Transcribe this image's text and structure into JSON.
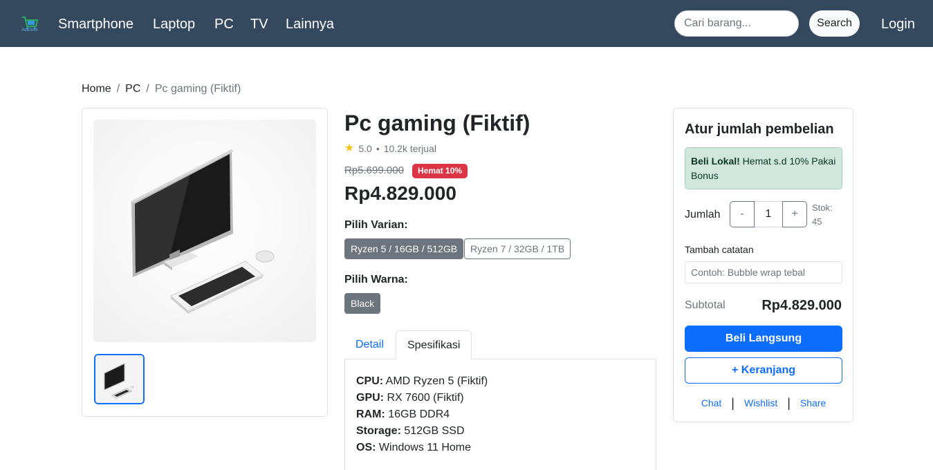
{
  "nav": {
    "logo_text": "AdaTech",
    "links": [
      "Smartphone",
      "Laptop",
      "PC",
      "TV",
      "Lainnya"
    ],
    "search_placeholder": "Cari barang...",
    "search_button": "Search",
    "login": "Login"
  },
  "breadcrumb": {
    "items": [
      "Home",
      "PC"
    ],
    "current": "Pc gaming (Fiktif)"
  },
  "product": {
    "title": "Pc gaming (Fiktif)",
    "rating": "5.0",
    "sold": "10.2k terjual",
    "rating_separator": "•",
    "old_price": "Rp5.699.000",
    "discount_badge": "Hemat 10%",
    "price": "Rp4.829.000",
    "variant_label": "Pilih Varian:",
    "variants": [
      "Ryzen 5 / 16GB / 512GB",
      "Ryzen 7 / 32GB / 1TB"
    ],
    "color_label": "Pilih Warna:",
    "colors": [
      "Black"
    ]
  },
  "tabs": {
    "items": [
      "Detail",
      "Spesifikasi"
    ],
    "active": "Spesifikasi"
  },
  "specs": [
    {
      "key": "CPU:",
      "value": "AMD Ryzen 5 (Fiktif)"
    },
    {
      "key": "GPU:",
      "value": "RX 7600 (Fiktif)"
    },
    {
      "key": "RAM:",
      "value": "16GB DDR4"
    },
    {
      "key": "Storage:",
      "value": "512GB SSD"
    },
    {
      "key": "OS:",
      "value": "Windows 11 Home"
    }
  ],
  "purchase": {
    "title": "Atur jumlah pembelian",
    "promo_bold": "Beli Lokal!",
    "promo_text": " Hemat s.d 10% Pakai Bonus",
    "qty_label": "Jumlah",
    "qty_minus": "-",
    "qty_value": "1",
    "qty_plus": "+",
    "stock_label": "Stok:",
    "stock_value": "45",
    "note_label": "Tambah catatan",
    "note_placeholder": "Contoh: Bubble wrap tebal",
    "subtotal_label": "Subtotal",
    "subtotal_value": "Rp4.829.000",
    "buy_button": "Beli Langsung",
    "cart_button": "+ Keranjang",
    "actions": [
      "Chat",
      "Wishlist",
      "Share"
    ],
    "action_separator": "|"
  },
  "colors": {
    "navbar": "#34495e",
    "primary": "#0d6efd",
    "danger": "#dc3545",
    "secondary": "#6c757d",
    "success_bg": "#d1e7dd",
    "star": "#f5c518"
  }
}
